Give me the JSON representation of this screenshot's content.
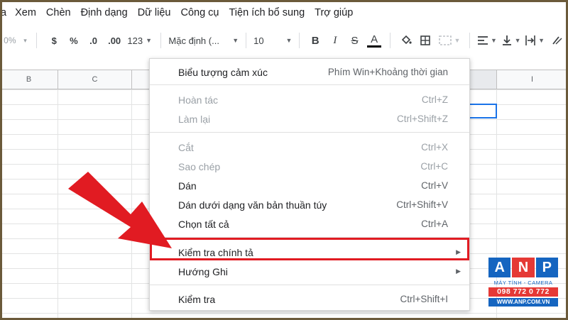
{
  "menubar": {
    "items": [
      "a",
      "Xem",
      "Chèn",
      "Định dạng",
      "Dữ liệu",
      "Công cụ",
      "Tiện ích bổ sung",
      "Trợ giúp"
    ]
  },
  "toolbar": {
    "zoom": "0%",
    "currency": "$",
    "percent": "%",
    "decrease_decimal": ".0",
    "increase_decimal": ".00",
    "more_formats": "123",
    "font": "Mặc định (...",
    "font_size": "10",
    "bold": "B",
    "italic": "I",
    "strike": "S",
    "text_color": "A"
  },
  "sheet": {
    "columns": [
      "B",
      "C",
      "I"
    ]
  },
  "context_menu": {
    "items": [
      {
        "label": "Biểu tượng cảm xúc",
        "shortcut": "Phím Win+Khoảng thời gian",
        "enabled": true
      },
      {
        "label": "Hoàn tác",
        "shortcut": "Ctrl+Z",
        "enabled": false
      },
      {
        "label": "Làm lại",
        "shortcut": "Ctrl+Shift+Z",
        "enabled": false
      },
      {
        "label": "Cắt",
        "shortcut": "Ctrl+X",
        "enabled": false
      },
      {
        "label": "Sao chép",
        "shortcut": "Ctrl+C",
        "enabled": false
      },
      {
        "label": "Dán",
        "shortcut": "Ctrl+V",
        "enabled": true
      },
      {
        "label": "Dán dưới dạng văn bản thuần túy",
        "shortcut": "Ctrl+Shift+V",
        "enabled": true
      },
      {
        "label": "Chọn tất cả",
        "shortcut": "Ctrl+A",
        "enabled": true
      },
      {
        "label": "Kiểm tra chính tả",
        "shortcut": "",
        "enabled": true
      },
      {
        "label": "Hướng Ghi",
        "shortcut": "",
        "enabled": true
      },
      {
        "label": "Kiểm tra",
        "shortcut": "Ctrl+Shift+I",
        "enabled": true
      }
    ]
  },
  "logo": {
    "letters": [
      "A",
      "N",
      "P"
    ],
    "tagline": "MÁY TÍNH - CAMERA",
    "phone": "098 772 0 772",
    "website": "WWW.ANP.COM.VN"
  },
  "colors": {
    "highlight": "#e11b22",
    "arrow": "#e11b22",
    "selection": "#1a73e8",
    "logo_blue": "#1565c0",
    "logo_red": "#e53935"
  }
}
